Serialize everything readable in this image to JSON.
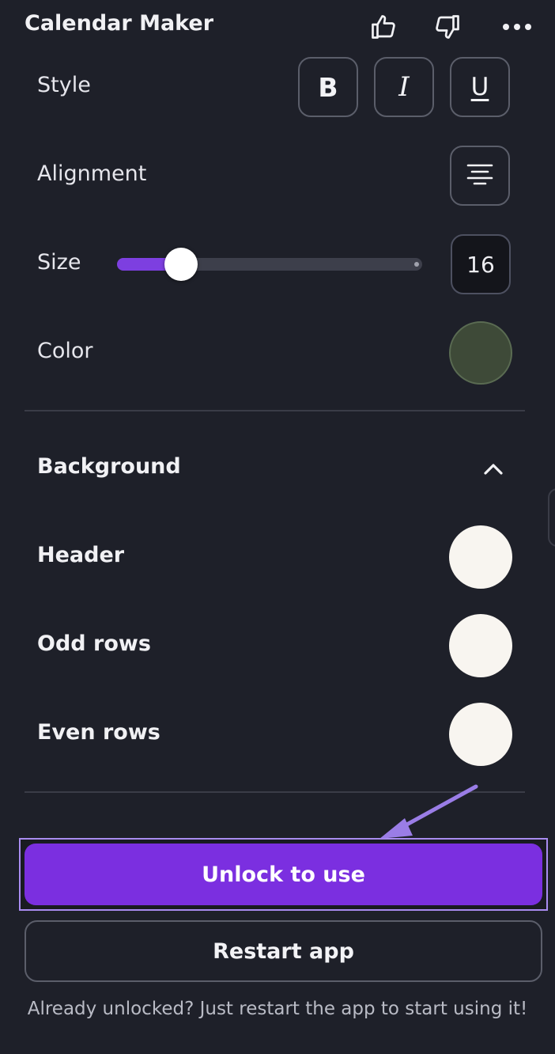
{
  "header": {
    "title": "Calendar Maker",
    "icons": [
      "thumbs-up-icon",
      "thumbs-down-icon",
      "more-icon"
    ]
  },
  "text_style": {
    "style_label": "Style",
    "bold_glyph": "B",
    "italic_glyph": "I",
    "underline_glyph": "U",
    "alignment_label": "Alignment",
    "alignment_icon": "align-center-icon",
    "size_label": "Size",
    "size_value": "16",
    "slider_fraction": 0.19,
    "color_label": "Color",
    "color_value": "#3e4a38"
  },
  "background": {
    "section_title": "Background",
    "collapse_icon": "chevron-up-icon",
    "header_label": "Header",
    "header_color": "#f8f5f0",
    "odd_rows_label": "Odd rows",
    "odd_rows_color": "#f8f5f0",
    "even_rows_label": "Even rows",
    "even_rows_color": "#f8f5f0"
  },
  "actions": {
    "unlock_label": "Unlock to use",
    "restart_label": "Restart app",
    "footer_note": "Already unlocked? Just restart the app to start using it!"
  },
  "colors": {
    "accent": "#7b2fe0",
    "background": "#1e2029"
  }
}
